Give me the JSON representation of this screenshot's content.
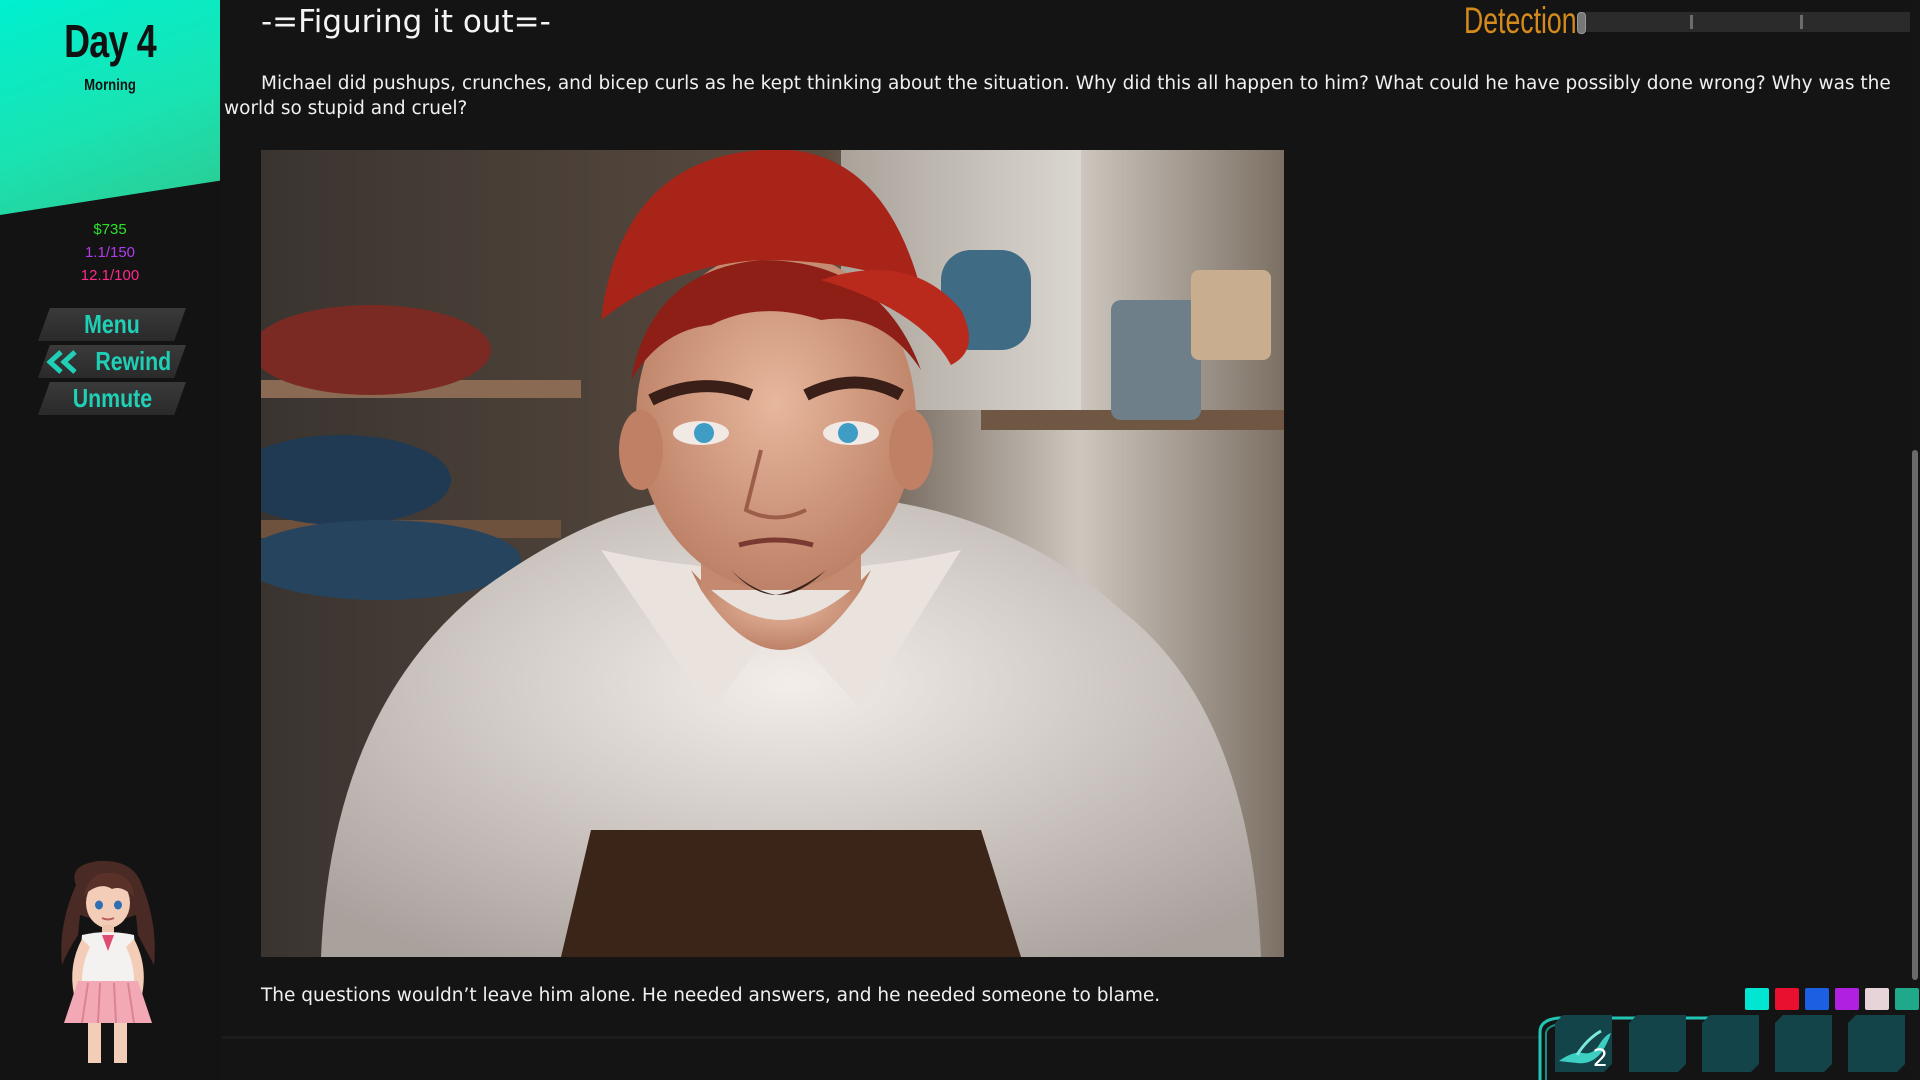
{
  "day": {
    "title": "Day 4",
    "time": "Morning"
  },
  "stats": {
    "money": "$735",
    "stat_b": "1.1/150",
    "stat_c": "12.1/100"
  },
  "buttons": {
    "menu": "Menu",
    "rewind": "Rewind",
    "unmute": "Unmute"
  },
  "chapter_title": "-=Figuring it out=-",
  "paragraph1": "Michael did pushups, crunches, and bicep curls as he kept thinking about the situation.  Why did this all happen to him?  What could he have possibly done wrong?  Why was the world so stupid and cruel?",
  "paragraph2": "The questions wouldn’t leave him alone.  He needed answers, and he needed someone to blame.",
  "detection": {
    "label": "Detection",
    "level": 0.0
  },
  "palette": [
    "#00e6d2",
    "#e8102e",
    "#1c5fe3",
    "#b020e0",
    "#e6d4d8",
    "#1fa88a"
  ],
  "inventory": {
    "first_slot_count": "2"
  },
  "colors": {
    "accent": "#1fd0b6",
    "money": "#2ce12c",
    "detection": "#d58a1c"
  }
}
